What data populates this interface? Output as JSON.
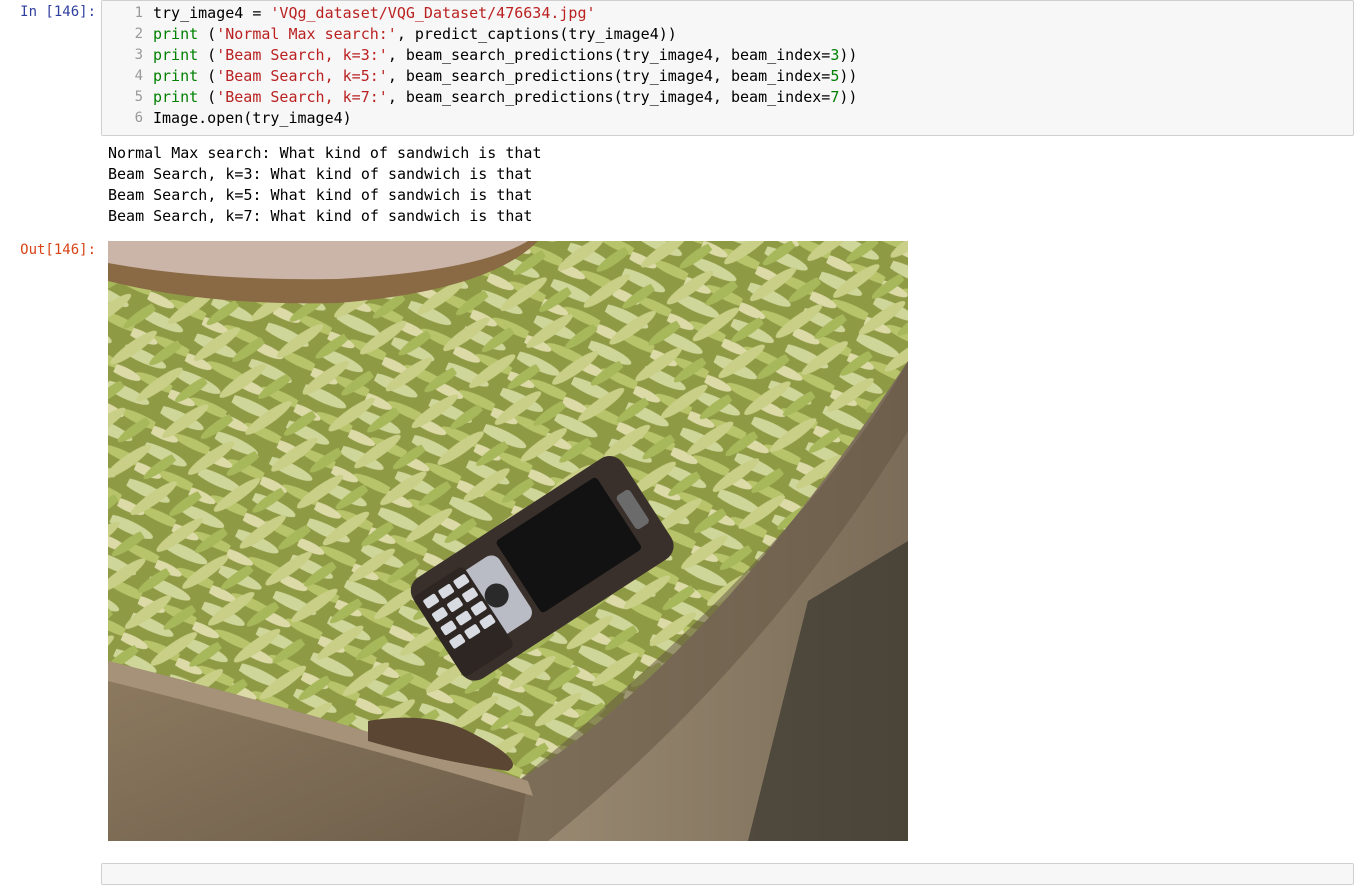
{
  "cell_in": {
    "prompt": "In [146]:",
    "lines": [
      {
        "n": "1",
        "parts": [
          [
            "plain",
            "try_image4 = "
          ],
          [
            "str",
            "'VQg_dataset/VQG_Dataset/476634.jpg'"
          ]
        ]
      },
      {
        "n": "2",
        "parts": [
          [
            "kw",
            "print"
          ],
          [
            "plain",
            " ("
          ],
          [
            "str",
            "'Normal Max search:'"
          ],
          [
            "plain",
            ", predict_captions(try_image4))"
          ]
        ]
      },
      {
        "n": "3",
        "parts": [
          [
            "kw",
            "print"
          ],
          [
            "plain",
            " ("
          ],
          [
            "str",
            "'Beam Search, k=3:'"
          ],
          [
            "plain",
            ", beam_search_predictions(try_image4, beam_index="
          ],
          [
            "num",
            "3"
          ],
          [
            "plain",
            "))"
          ]
        ]
      },
      {
        "n": "4",
        "parts": [
          [
            "kw",
            "print"
          ],
          [
            "plain",
            " ("
          ],
          [
            "str",
            "'Beam Search, k=5:'"
          ],
          [
            "plain",
            ", beam_search_predictions(try_image4, beam_index="
          ],
          [
            "num",
            "5"
          ],
          [
            "plain",
            "))"
          ]
        ]
      },
      {
        "n": "5",
        "parts": [
          [
            "kw",
            "print"
          ],
          [
            "plain",
            " ("
          ],
          [
            "str",
            "'Beam Search, k=7:'"
          ],
          [
            "plain",
            ", beam_search_predictions(try_image4, beam_index="
          ],
          [
            "num",
            "7"
          ],
          [
            "plain",
            "))"
          ]
        ]
      },
      {
        "n": "6",
        "parts": [
          [
            "plain",
            "Image.open(try_image4)"
          ]
        ]
      }
    ]
  },
  "stdout": [
    "Normal Max search: What kind of sandwich is that",
    "Beam Search, k=3: What kind of sandwich is that",
    "Beam Search, k=5: What kind of sandwich is that",
    "Beam Search, k=7: What kind of sandwich is that"
  ],
  "cell_out": {
    "prompt": "Out[146]:"
  },
  "colors": {
    "in_prompt": "#303f9f",
    "out_prompt": "#d84315",
    "string": "#ba2121",
    "keyword": "#008000"
  }
}
